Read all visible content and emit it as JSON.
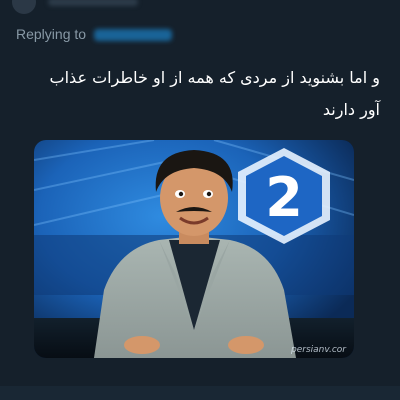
{
  "reply": {
    "prefix": "Replying to"
  },
  "tweet": {
    "text": "و اما بشنوید از مردی که همه از او خاطرات عذاب آور دارند"
  },
  "media": {
    "watermark": "persianv.cor",
    "channel_logo": "2",
    "colors": {
      "studio_blue": "#1b63b8",
      "suit": "#9aa6a3",
      "desk": "#0d1a24"
    }
  }
}
